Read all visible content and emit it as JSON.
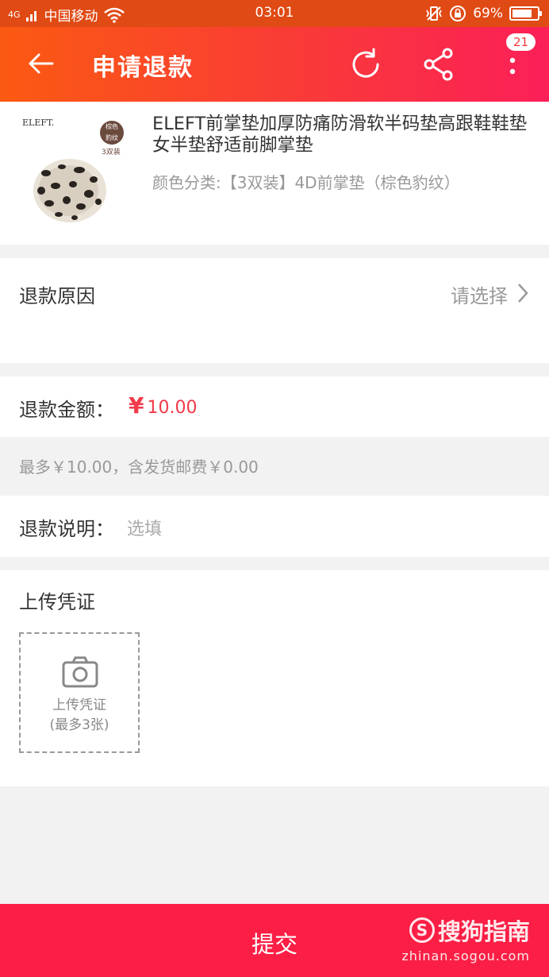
{
  "status_bar": {
    "network": "4G",
    "carrier": "中国移动",
    "time": "03:01",
    "battery": "69%"
  },
  "header": {
    "title": "申请退款",
    "badge": "21"
  },
  "product": {
    "brand": "ELEFT.",
    "image_tag": "棕色\n豹纹",
    "image_pack": "3双装",
    "title": "ELEFT前掌垫加厚防痛防滑软半码垫高跟鞋鞋垫女半垫舒适前脚掌垫",
    "sku": "颜色分类:【3双装】4D前掌垫（棕色豹纹）"
  },
  "reason": {
    "label": "退款原因",
    "select": "请选择"
  },
  "amount": {
    "label": "退款金额：",
    "currency": "¥",
    "value": "10.00"
  },
  "hint": "最多￥10.00，含发货邮费￥0.00",
  "note": {
    "label": "退款说明：",
    "placeholder": "选填"
  },
  "upload": {
    "label": "上传凭证",
    "box_line1": "上传凭证",
    "box_line2": "(最多3张)"
  },
  "submit": {
    "label": "提交"
  },
  "watermark": {
    "cn": "搜狗指南",
    "en": "zhinan.sogou.com"
  },
  "colors": {
    "header_start": "#fb5a12",
    "header_end": "#fb1f58",
    "submit_bg": "#fb1f45",
    "price": "#f23a4a"
  }
}
